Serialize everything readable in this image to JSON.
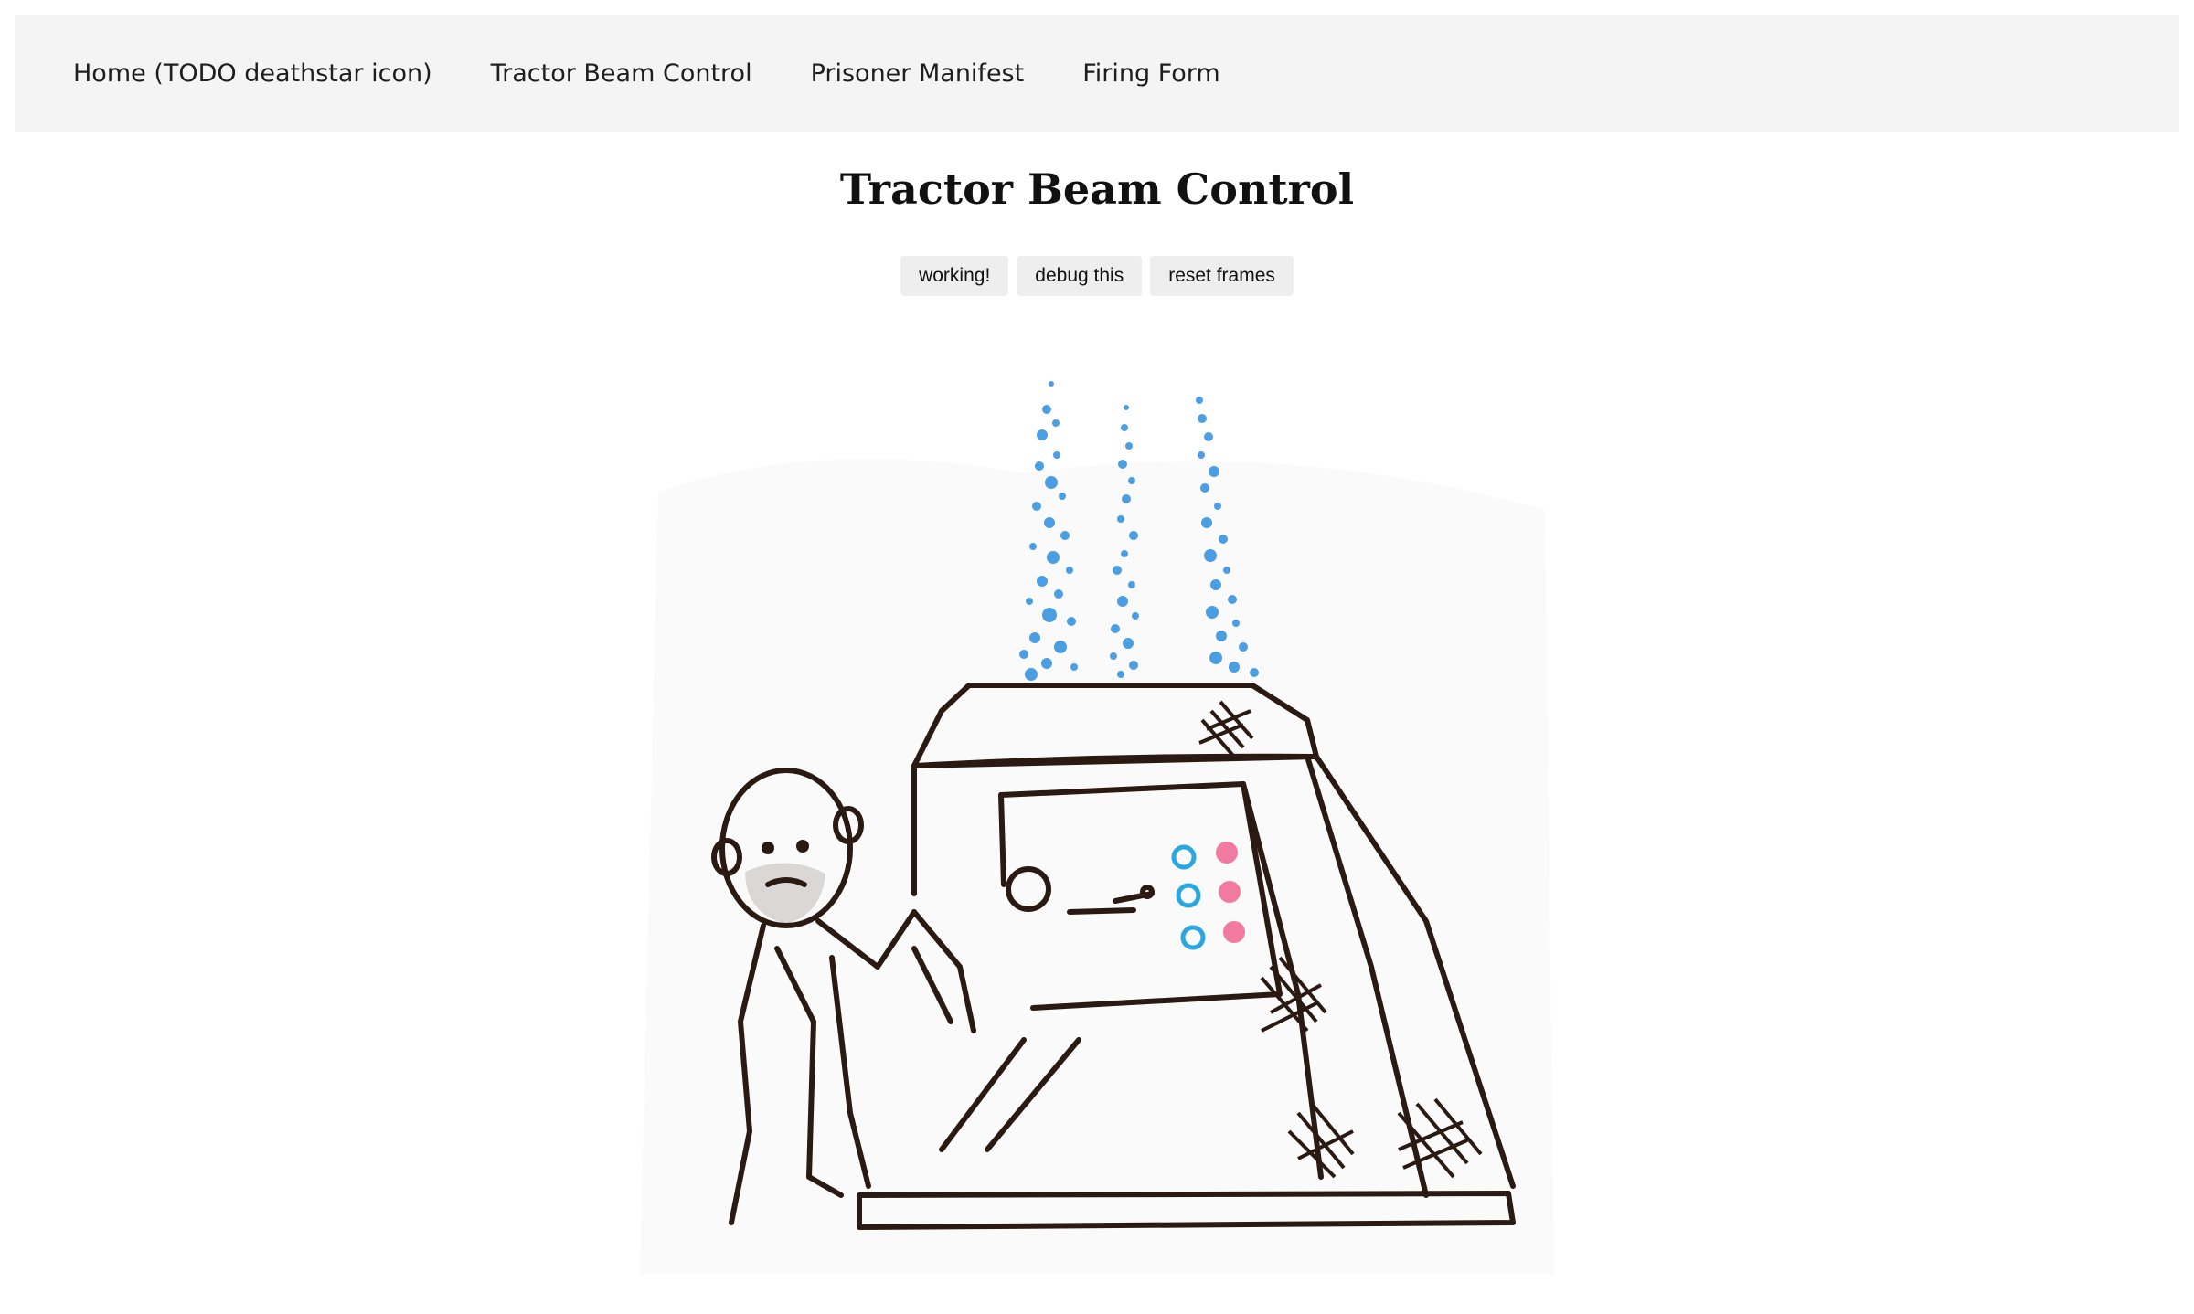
{
  "nav": {
    "items": [
      {
        "label": "Home (TODO deathstar icon)"
      },
      {
        "label": "Tractor Beam Control"
      },
      {
        "label": "Prisoner Manifest"
      },
      {
        "label": "Firing Form"
      }
    ]
  },
  "page": {
    "title": "Tractor Beam Control"
  },
  "buttons": {
    "working_label": "working!",
    "debug_label": "debug this",
    "reset_label": "reset frames"
  },
  "colors": {
    "nav_bg": "#f4f4f4",
    "button_bg": "#eeeeee",
    "ink": "#2a1a12",
    "beam_blue": "#2e8fe0",
    "control_cyan": "#29a7e1",
    "control_pink": "#f07aa0"
  }
}
